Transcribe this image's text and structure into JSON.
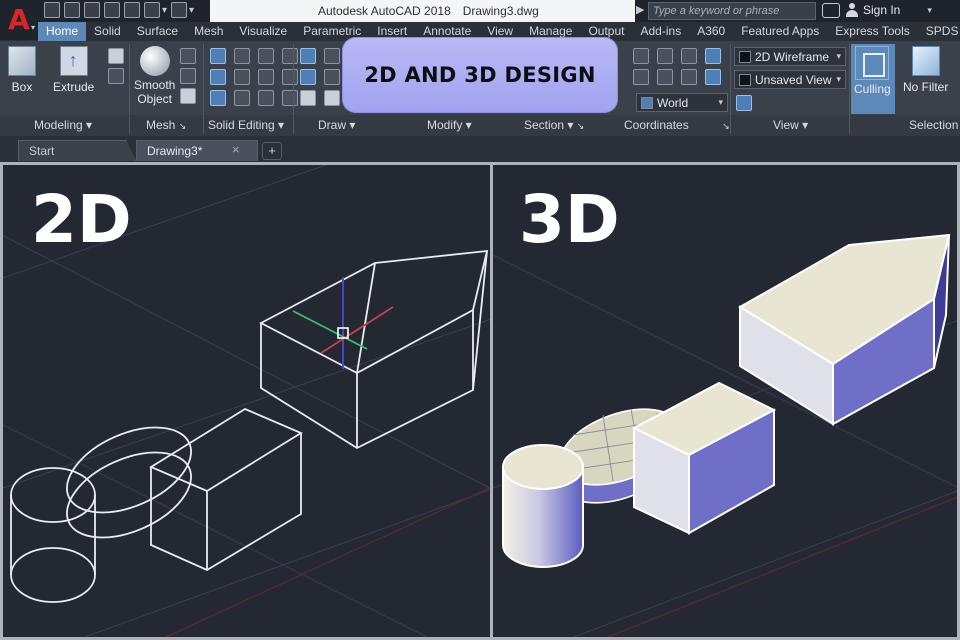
{
  "titlebar": {
    "app_logo": "A",
    "product": "Autodesk AutoCAD 2018",
    "document": "Drawing3.dwg",
    "search_placeholder": "Type a keyword or phrase",
    "sign_in": "Sign In"
  },
  "ribbon_tabs": [
    "Home",
    "Solid",
    "Surface",
    "Mesh",
    "Visualize",
    "Parametric",
    "Insert",
    "Annotate",
    "View",
    "Manage",
    "Output",
    "Add-ins",
    "A360",
    "Featured Apps",
    "Express Tools",
    "SPDS"
  ],
  "active_tab": "Home",
  "ribbon": {
    "buttons": {
      "box": "Box",
      "extrude": "Extrude",
      "smooth_line1": "Smooth",
      "smooth_line2": "Object",
      "culling": "Culling",
      "no_filter": "No Filter"
    },
    "combos": {
      "visual_style": "2D Wireframe",
      "named_view": "Unsaved View",
      "ucs": "World"
    },
    "panels": {
      "modeling": "Modeling",
      "mesh": "Mesh",
      "solid_editing": "Solid Editing",
      "draw": "Draw",
      "modify": "Modify",
      "section": "Section",
      "coordinates": "Coordinates",
      "view": "View",
      "selection": "Selection"
    }
  },
  "overlay_label": "2D AND 3D DESIGN",
  "file_tabs": {
    "start": "Start",
    "drawing": "Drawing3*"
  },
  "viewports": {
    "left_label": "2D",
    "right_label": "3D"
  },
  "colors": {
    "accent_tab": "#5d89b8",
    "viewport_bg": "#232833",
    "badge_bg": "#a9a9f2",
    "solid_face_light": "#e8e6d2",
    "solid_face_blue": "#6f6fc8"
  }
}
